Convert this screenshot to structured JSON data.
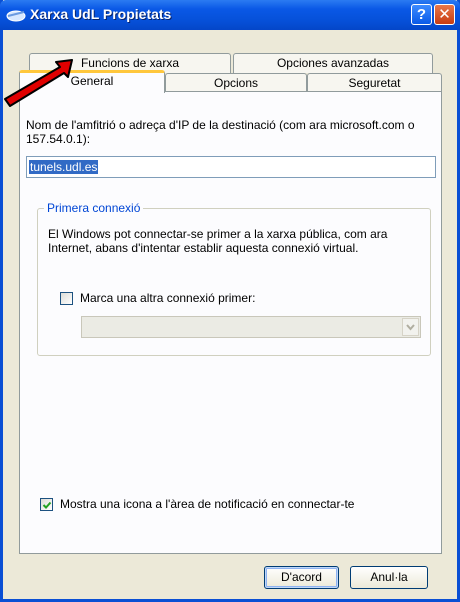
{
  "window": {
    "title": "Xarxa UdL Propietats",
    "help_label": "?",
    "close_label": "✕"
  },
  "tabs": {
    "row_back": [
      {
        "label": "Funcions de xarxa"
      },
      {
        "label": "Opciones avanzadas"
      }
    ],
    "row_front": [
      {
        "label": "General",
        "selected": true
      },
      {
        "label": "Opcions"
      },
      {
        "label": "Seguretat"
      }
    ]
  },
  "general": {
    "host_description": "Nom de l'amfitrió o adreça d'IP de la destinació (com ara microsoft.com o 157.54.0.1):",
    "host_value": "tunels.udl.es",
    "first_connection": {
      "title": "Primera connexió",
      "text": "El Windows pot connectar-se primer a la xarxa pública, com ara Internet, abans d'intentar establir aquesta connexió virtual.",
      "dial_first_label": "Marca una altra connexió primer:",
      "dial_first_checked": false,
      "dial_first_selected": ""
    },
    "show_icon_label": "Mostra una icona a l'àrea de notificació en connectar-te",
    "show_icon_checked": true
  },
  "buttons": {
    "ok": "D'acord",
    "cancel": "Anul·la"
  },
  "colors": {
    "titlebar": "#0a58e6",
    "group_title": "#0046d5",
    "selection": "#316ac5",
    "active_tab_accent": "#ffc73c",
    "annotation_arrow": "#e00000"
  },
  "icons": [
    "network-connection-icon",
    "help-icon",
    "close-icon",
    "checkmark-icon",
    "dropdown-arrow-icon",
    "annotation-arrow-icon"
  ]
}
